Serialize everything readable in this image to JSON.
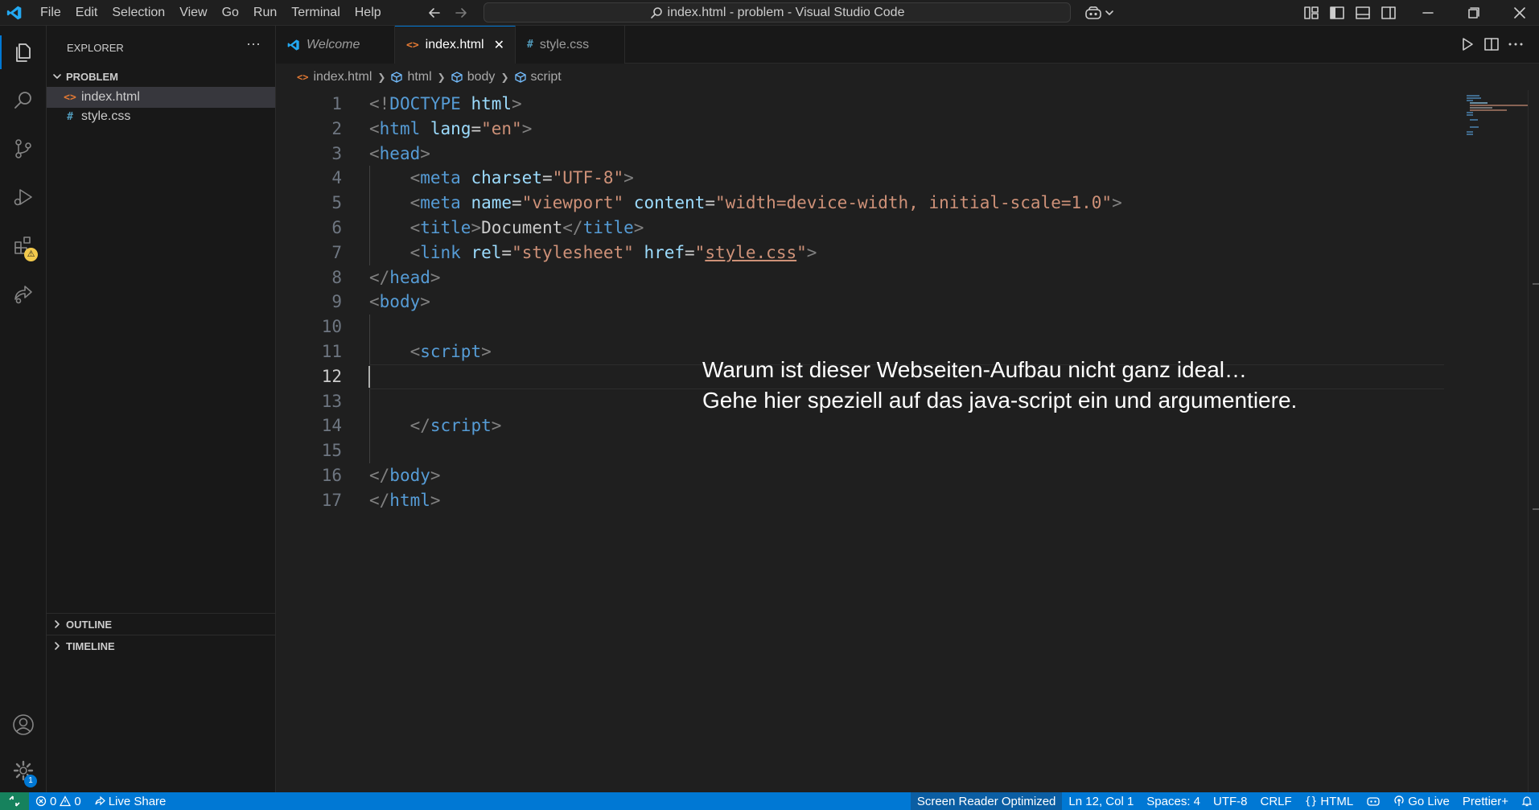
{
  "titlebar": {
    "menu": [
      "File",
      "Edit",
      "Selection",
      "View",
      "Go",
      "Run",
      "Terminal",
      "Help"
    ],
    "command_center": "index.html - problem - Visual Studio Code"
  },
  "sidebar": {
    "title": "EXPLORER",
    "more": "···",
    "folder": "PROBLEM",
    "files": [
      {
        "icon": "<>",
        "name": "index.html"
      },
      {
        "icon": "#",
        "name": "style.css"
      }
    ],
    "sections": [
      "OUTLINE",
      "TIMELINE"
    ]
  },
  "activitybar": {
    "extensions_badge": "⚠",
    "settings_badge": "1"
  },
  "tabs": [
    {
      "label": "Welcome"
    },
    {
      "icon": "<>",
      "label": "index.html",
      "close": "✕"
    },
    {
      "icon": "#",
      "label": "style.css"
    }
  ],
  "breadcrumbs": [
    {
      "icon": "<>",
      "label": "index.html"
    },
    {
      "label": "html"
    },
    {
      "label": "body"
    },
    {
      "label": "script"
    }
  ],
  "editor": {
    "line_numbers": [
      "1",
      "2",
      "3",
      "4",
      "5",
      "6",
      "7",
      "8",
      "9",
      "10",
      "11",
      "12",
      "13",
      "14",
      "15",
      "16",
      "17"
    ],
    "current_line": 12,
    "lines": [
      [
        [
          "p",
          "<!"
        ],
        [
          "t",
          "DOCTYPE"
        ],
        [
          "x",
          " "
        ],
        [
          "a",
          "html"
        ],
        [
          "p",
          ">"
        ]
      ],
      [
        [
          "p",
          "<"
        ],
        [
          "t",
          "html"
        ],
        [
          "x",
          " "
        ],
        [
          "a",
          "lang"
        ],
        [
          "x",
          "="
        ],
        [
          "s",
          "\"en\""
        ],
        [
          "p",
          ">"
        ]
      ],
      [
        [
          "p",
          "<"
        ],
        [
          "t",
          "head"
        ],
        [
          "p",
          ">"
        ]
      ],
      [
        [
          "x",
          "    "
        ],
        [
          "p",
          "<"
        ],
        [
          "t",
          "meta"
        ],
        [
          "x",
          " "
        ],
        [
          "a",
          "charset"
        ],
        [
          "x",
          "="
        ],
        [
          "s",
          "\"UTF-8\""
        ],
        [
          "p",
          ">"
        ]
      ],
      [
        [
          "x",
          "    "
        ],
        [
          "p",
          "<"
        ],
        [
          "t",
          "meta"
        ],
        [
          "x",
          " "
        ],
        [
          "a",
          "name"
        ],
        [
          "x",
          "="
        ],
        [
          "s",
          "\"viewport\""
        ],
        [
          "x",
          " "
        ],
        [
          "a",
          "content"
        ],
        [
          "x",
          "="
        ],
        [
          "s",
          "\"width=device-width, initial-scale=1.0\""
        ],
        [
          "p",
          ">"
        ]
      ],
      [
        [
          "x",
          "    "
        ],
        [
          "p",
          "<"
        ],
        [
          "t",
          "title"
        ],
        [
          "p",
          ">"
        ],
        [
          "x",
          "Document"
        ],
        [
          "p",
          "</"
        ],
        [
          "t",
          "title"
        ],
        [
          "p",
          ">"
        ]
      ],
      [
        [
          "x",
          "    "
        ],
        [
          "p",
          "<"
        ],
        [
          "t",
          "link"
        ],
        [
          "x",
          " "
        ],
        [
          "a",
          "rel"
        ],
        [
          "x",
          "="
        ],
        [
          "s",
          "\"stylesheet\""
        ],
        [
          "x",
          " "
        ],
        [
          "a",
          "href"
        ],
        [
          "x",
          "="
        ],
        [
          "s",
          "\""
        ],
        [
          "l",
          "style.css"
        ],
        [
          "s",
          "\""
        ],
        [
          "p",
          ">"
        ]
      ],
      [
        [
          "p",
          "</"
        ],
        [
          "t",
          "head"
        ],
        [
          "p",
          ">"
        ]
      ],
      [
        [
          "p",
          "<"
        ],
        [
          "t",
          "body"
        ],
        [
          "p",
          ">"
        ]
      ],
      [],
      [
        [
          "x",
          "    "
        ],
        [
          "p",
          "<"
        ],
        [
          "t",
          "script"
        ],
        [
          "p",
          ">"
        ]
      ],
      [],
      [],
      [
        [
          "x",
          "    "
        ],
        [
          "p",
          "</"
        ],
        [
          "t",
          "script"
        ],
        [
          "p",
          ">"
        ]
      ],
      [],
      [
        [
          "p",
          "</"
        ],
        [
          "t",
          "body"
        ],
        [
          "p",
          ">"
        ]
      ],
      [
        [
          "p",
          "</"
        ],
        [
          "t",
          "html"
        ],
        [
          "p",
          ">"
        ]
      ]
    ],
    "overlay_lines": [
      "Warum ist dieser Webseiten-Aufbau nicht ganz ideal…",
      "Gehe hier speziell auf das java-script ein und argumentiere."
    ]
  },
  "statusbar": {
    "problems_errors": "0",
    "problems_warnings": "0",
    "live_share": "Live Share",
    "screen_reader": "Screen Reader Optimized",
    "cursor_position": "Ln 12, Col 1",
    "spaces": "Spaces: 4",
    "encoding": "UTF-8",
    "eol": "CRLF",
    "language": "HTML",
    "go_live": "Go Live",
    "prettier": "Prettier+"
  },
  "colors": {
    "accent": "#0078d4",
    "remote": "#16825d",
    "html_icon": "#e37933",
    "css_icon": "#519aba",
    "vscode_logo": "#23a9f2"
  }
}
